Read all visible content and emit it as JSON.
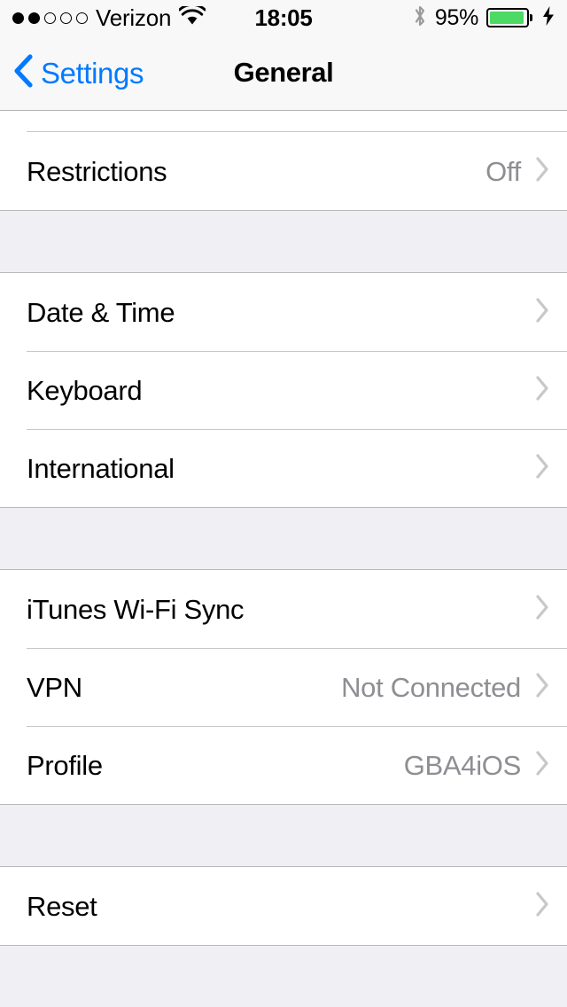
{
  "status_bar": {
    "carrier": "Verizon",
    "signal_bars_filled": 2,
    "signal_bars_total": 5,
    "wifi_icon": "wifi-icon",
    "time": "18:05",
    "bluetooth_icon": "bluetooth-icon",
    "battery_percent_label": "95%",
    "battery_level": 95,
    "battery_color": "#4CD964",
    "charging_icon": "charging-bolt-icon"
  },
  "nav_bar": {
    "back_label": "Settings",
    "back_icon": "chevron-left-icon",
    "title": "General",
    "accent_color": "#007AFF"
  },
  "groups": [
    {
      "id": "group-restrictions",
      "rows": [
        {
          "label": "Restrictions",
          "value": "Off",
          "accessory": "chevron-right-icon"
        }
      ]
    },
    {
      "id": "group-locale",
      "rows": [
        {
          "label": "Date & Time",
          "value": "",
          "accessory": "chevron-right-icon"
        },
        {
          "label": "Keyboard",
          "value": "",
          "accessory": "chevron-right-icon"
        },
        {
          "label": "International",
          "value": "",
          "accessory": "chevron-right-icon"
        }
      ]
    },
    {
      "id": "group-connectivity",
      "rows": [
        {
          "label": "iTunes Wi-Fi Sync",
          "value": "",
          "accessory": "chevron-right-icon"
        },
        {
          "label": "VPN",
          "value": "Not Connected",
          "accessory": "chevron-right-icon"
        },
        {
          "label": "Profile",
          "value": "GBA4iOS",
          "accessory": "chevron-right-icon"
        }
      ]
    },
    {
      "id": "group-reset",
      "rows": [
        {
          "label": "Reset",
          "value": "",
          "accessory": "chevron-right-icon"
        }
      ]
    }
  ]
}
